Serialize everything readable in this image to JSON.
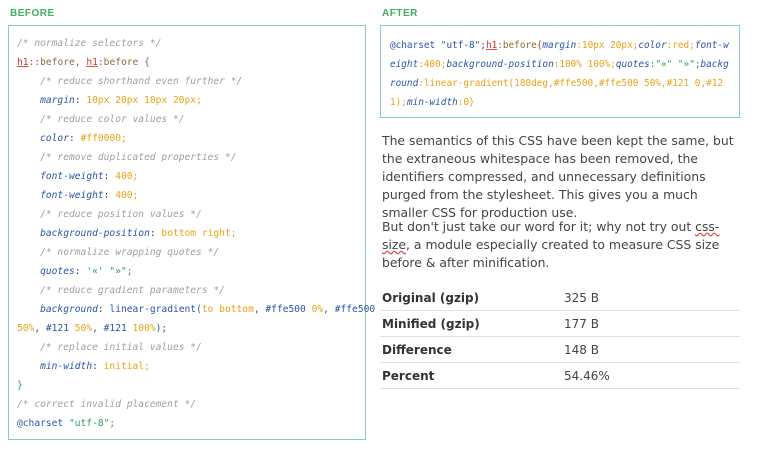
{
  "before_heading": "BEFORE",
  "after_heading": "AFTER",
  "before_code": {
    "c1": "/* normalize selectors */",
    "sel1": "h1",
    "sel1b": "::before, ",
    "sel2": "h1",
    "sel2b": ":before {",
    "c2": "/* reduce shorthand even further */",
    "p_margin": "margin",
    "v_margin": "10px 20px 10px 20px;",
    "c3": "/* reduce color values */",
    "p_color": "color",
    "v_color": "#ff0000;",
    "c4": "/* remove duplicated properties */",
    "p_fw1": "font-weight",
    "v_fw1": "400;",
    "p_fw2": "font-weight",
    "v_fw2": "400;",
    "c5": "/* reduce position values */",
    "p_bgpos": "background-position",
    "v_bgpos": "bottom right;",
    "c6": "/* normalize wrapping quotes */",
    "p_quotes": "quotes",
    "v_quotes": "'«' \"»\";",
    "c7": "/* reduce gradient parameters */",
    "p_bg": "background",
    "v_bg_fn": "linear-gradient(",
    "v_bg_a": "to bottom",
    "v_bg_b": ", #ffe500 ",
    "v_bg_c": "0%",
    "v_bg_d": ", #ffe500",
    "v_bg_e": "50%",
    "v_bg_f": ", #121 ",
    "v_bg_g": "50%",
    "v_bg_h": ", #121 ",
    "v_bg_i": "100%",
    "v_bg_j": ");",
    "c8": "/* replace initial values */",
    "p_minw": "min-width",
    "v_minw": "initial;",
    "close": "}",
    "c9": "/* correct invalid placement */",
    "at": "@charset",
    "at_val": "\"utf-8\";"
  },
  "after_code": {
    "a1": "@charset \"utf-8\";",
    "a_sel": "h1",
    "a_rest1": ":before{",
    "a_p1": "margin",
    "a_v1": ":10px 20px;",
    "a_p2": "color",
    "a_v2": ":red;",
    "a_p3": "font-weight",
    "a_v3": ":400;",
    "a_p4": "background-position",
    "a_v4": ":100% 100%;",
    "a_p5": "quotes",
    "a_v5": ":\"«\" \"»\";",
    "a_p6": "background",
    "a_v6": ":linear-gradient(180deg,#ffe500,#ffe500 50%,#121 0,#121);",
    "a_p7": "min-width",
    "a_v7": ":0}"
  },
  "para1": "The semantics of this CSS have been kept the same, but the extraneous whitespace has been removed, the identifiers compressed, and unnecessary definitions purged from the stylesheet. This gives you a much smaller CSS for production use.",
  "para2_before": "But don't just take our word for it; why not try out ",
  "para2_link": "css-size",
  "para2_after": ", a module especially created to measure CSS size before & after minification.",
  "stats": [
    {
      "label": "Original (gzip)",
      "value": "325 B"
    },
    {
      "label": "Minified (gzip)",
      "value": "177 B"
    },
    {
      "label": "Difference",
      "value": "148 B"
    },
    {
      "label": "Percent",
      "value": "54.46%"
    }
  ]
}
